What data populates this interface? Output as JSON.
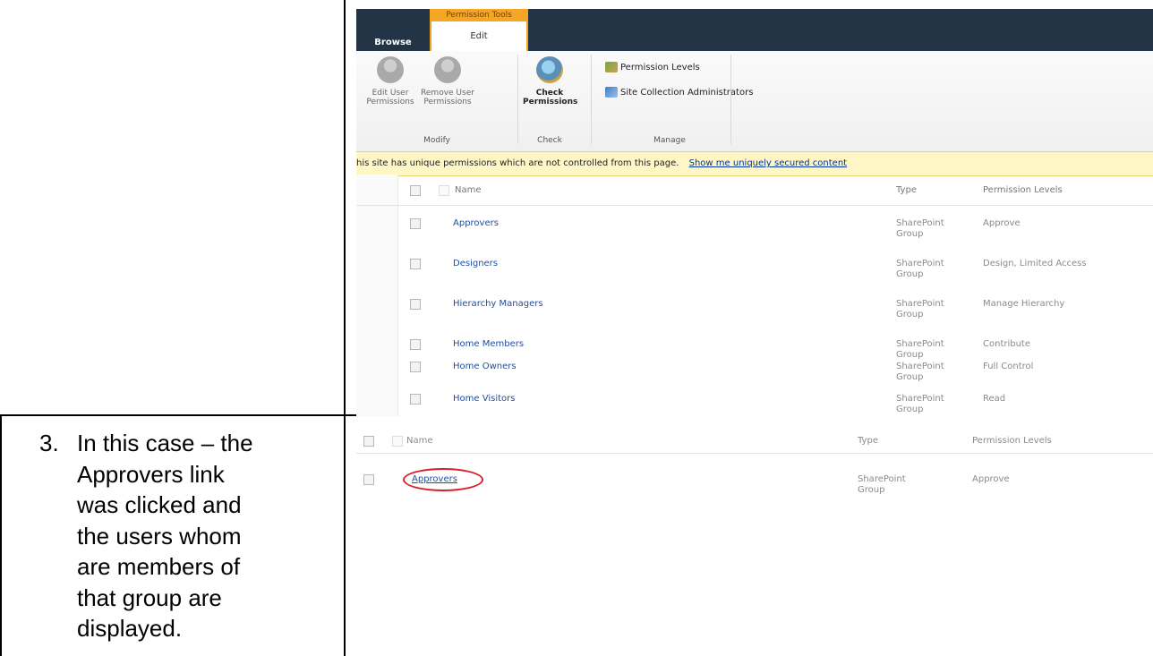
{
  "step": {
    "number": "3.",
    "lines": [
      "In this case – the",
      "Approvers link",
      "was clicked and",
      "the users whom",
      "are members of",
      "that group are",
      "displayed."
    ]
  },
  "ribbon": {
    "context_group": "Permission Tools",
    "tabs": [
      "Browse",
      "Edit"
    ],
    "buttons": {
      "edit_user_permissions": [
        "Edit User",
        "Permissions"
      ],
      "remove_user_permissions": [
        "Remove User",
        "Permissions"
      ],
      "check_permissions": [
        "Check",
        "Permissions"
      ]
    },
    "groups": [
      "Modify",
      "Check",
      "Manage"
    ],
    "manage_items": [
      "Permission Levels",
      "Site Collection Administrators"
    ]
  },
  "infobar": {
    "text": "his site has unique permissions which are not controlled from this page.",
    "link": "Show me uniquely secured content"
  },
  "grid": {
    "columns": [
      "Name",
      "Type",
      "Permission Levels"
    ],
    "rows": [
      {
        "name": "Approvers",
        "type": [
          "SharePoint",
          "Group"
        ],
        "level": "Approve"
      },
      {
        "name": "Designers",
        "type": [
          "SharePoint",
          "Group"
        ],
        "level": "Design, Limited Access"
      },
      {
        "name": "Hierarchy Managers",
        "type": [
          "SharePoint",
          "Group"
        ],
        "level": "Manage Hierarchy"
      },
      {
        "name": "Home Members",
        "type": [
          "SharePoint",
          "Group"
        ],
        "level": "Contribute"
      },
      {
        "name": "Home Owners",
        "type": [
          "SharePoint",
          "Group"
        ],
        "level": "Full Control"
      },
      {
        "name": "Home Visitors",
        "type": [
          "SharePoint",
          "Group"
        ],
        "level": "Read"
      }
    ]
  },
  "grid2": {
    "columns": [
      "Name",
      "Type",
      "Permission Levels"
    ],
    "row": {
      "name": "Approvers",
      "type": [
        "SharePoint",
        "Group"
      ],
      "level": "Approve"
    }
  },
  "colors": {
    "ribbon_dark": "#233446",
    "context_orange": "#f5a623",
    "link_blue": "#1f4e9e",
    "highlight_red": "#d4202a"
  }
}
